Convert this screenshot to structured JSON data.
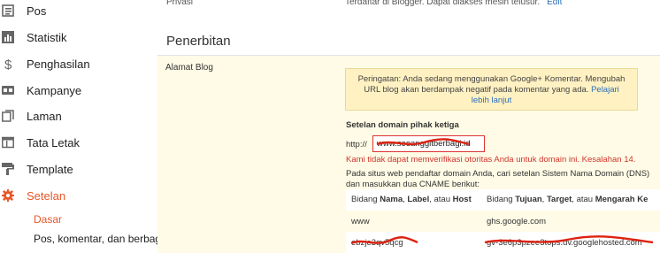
{
  "sidebar": {
    "items": [
      {
        "label": "Pos",
        "icon": "posts-icon"
      },
      {
        "label": "Statistik",
        "icon": "stats-icon"
      },
      {
        "label": "Penghasilan",
        "icon": "dollar-icon"
      },
      {
        "label": "Kampanye",
        "icon": "campaign-icon"
      },
      {
        "label": "Laman",
        "icon": "pages-icon"
      },
      {
        "label": "Tata Letak",
        "icon": "layout-icon"
      },
      {
        "label": "Template",
        "icon": "template-icon"
      },
      {
        "label": "Setelan",
        "icon": "gear-icon",
        "active": true
      }
    ],
    "sub_items": [
      {
        "label": "Dasar",
        "active": true
      },
      {
        "label": "Pos, komentar, dan berbagi"
      }
    ]
  },
  "privacy": {
    "label": "Privasi",
    "text": "Terdaftar di Blogger. Dapat diakses mesin telusur.",
    "edit": "Edit"
  },
  "section": {
    "title": "Penerbitan"
  },
  "blog_address": {
    "label": "Alamat Blog",
    "warning_text": "Peringatan: Anda sedang menggunakan Google+ Komentar. Mengubah URL blog akan berdampak negatif pada komentar yang ada.",
    "warning_link": "Pelajari lebih lanjut",
    "domain_title": "Setelan domain pihak ketiga",
    "http_label": "http://",
    "domain_value": "www.seoanggitberbagi.id",
    "error": "Kami tidak dapat memverifikasi otoritas Anda untuk domain ini. Kesalahan 14.",
    "dns_instructions": "Pada situs web pendaftar domain Anda, cari setelan Sistem Nama Domain (DNS) dan masukkan dua CNAME berikut:",
    "dns_header_col1": {
      "pre": "Bidang ",
      "b1": "Nama",
      "mid1": ", ",
      "b2": "Label",
      "mid2": ", atau ",
      "b3": "Host"
    },
    "dns_header_col2": {
      "pre": "Bidang ",
      "b1": "Tujuan",
      "mid1": ", ",
      "b2": "Target",
      "mid2": ", atau ",
      "b3": "Mengarah Ke"
    },
    "dns_rows": [
      {
        "name": "www",
        "target": "ghs.google.com"
      },
      {
        "name": "ebzje3qv5qcg",
        "target": "gv-3e6p3pzee3tops.dv.googlehosted.com"
      }
    ]
  },
  "colors": {
    "accent": "#e8562a",
    "link": "#2a6ebb",
    "error": "#d0342c",
    "panel": "#fffbe6",
    "warning_bg": "#fff1c2"
  }
}
